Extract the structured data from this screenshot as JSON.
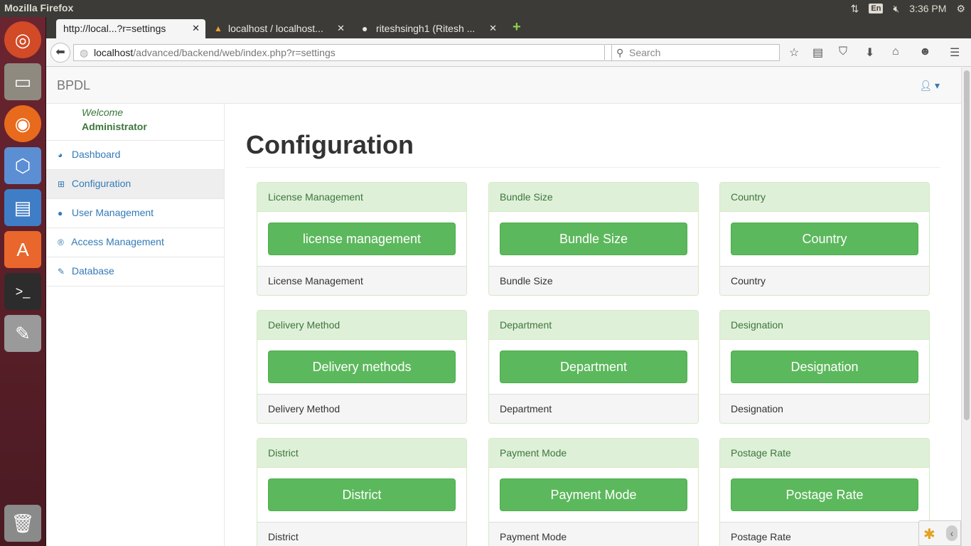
{
  "os": {
    "window_title": "Mozilla Firefox",
    "lang": "En",
    "time": "3:36 PM"
  },
  "tabs": [
    {
      "label": "http://local...?r=settings"
    },
    {
      "label": "localhost / localhost..."
    },
    {
      "label": "riteshsingh1 (Ritesh ..."
    }
  ],
  "address": {
    "host": "localhost",
    "path": "/advanced/backend/web/index.php?r=settings"
  },
  "search": {
    "placeholder": "Search"
  },
  "app": {
    "brand": "BPDL"
  },
  "sidebar": {
    "welcome": "Welcome",
    "user": "Administrator",
    "items": [
      {
        "label": "Dashboard",
        "icon": "dashboard-icon"
      },
      {
        "label": "Configuration",
        "icon": "table-icon"
      },
      {
        "label": "User Management",
        "icon": "user-icon"
      },
      {
        "label": "Access Management",
        "icon": "registered-icon"
      },
      {
        "label": "Database",
        "icon": "edit-icon"
      }
    ]
  },
  "page": {
    "title": "Configuration"
  },
  "panels": [
    {
      "heading": "License Management",
      "button": "license management",
      "footer": "License Management"
    },
    {
      "heading": "Bundle Size",
      "button": "Bundle Size",
      "footer": "Bundle Size"
    },
    {
      "heading": "Country",
      "button": "Country",
      "footer": "Country"
    },
    {
      "heading": "Delivery Method",
      "button": "Delivery methods",
      "footer": "Delivery Method"
    },
    {
      "heading": "Department",
      "button": "Department",
      "footer": "Department"
    },
    {
      "heading": "Designation",
      "button": "Designation",
      "footer": "Designation"
    },
    {
      "heading": "District",
      "button": "District",
      "footer": "District"
    },
    {
      "heading": "Payment Mode",
      "button": "Payment Mode",
      "footer": "Payment Mode"
    },
    {
      "heading": "Postage Rate",
      "button": "Postage Rate",
      "footer": "Postage Rate"
    }
  ],
  "colors": {
    "accent": "#5cb85c",
    "panel_heading_bg": "#dff0d8",
    "panel_heading_text": "#3c763d",
    "link": "#337ab7"
  }
}
